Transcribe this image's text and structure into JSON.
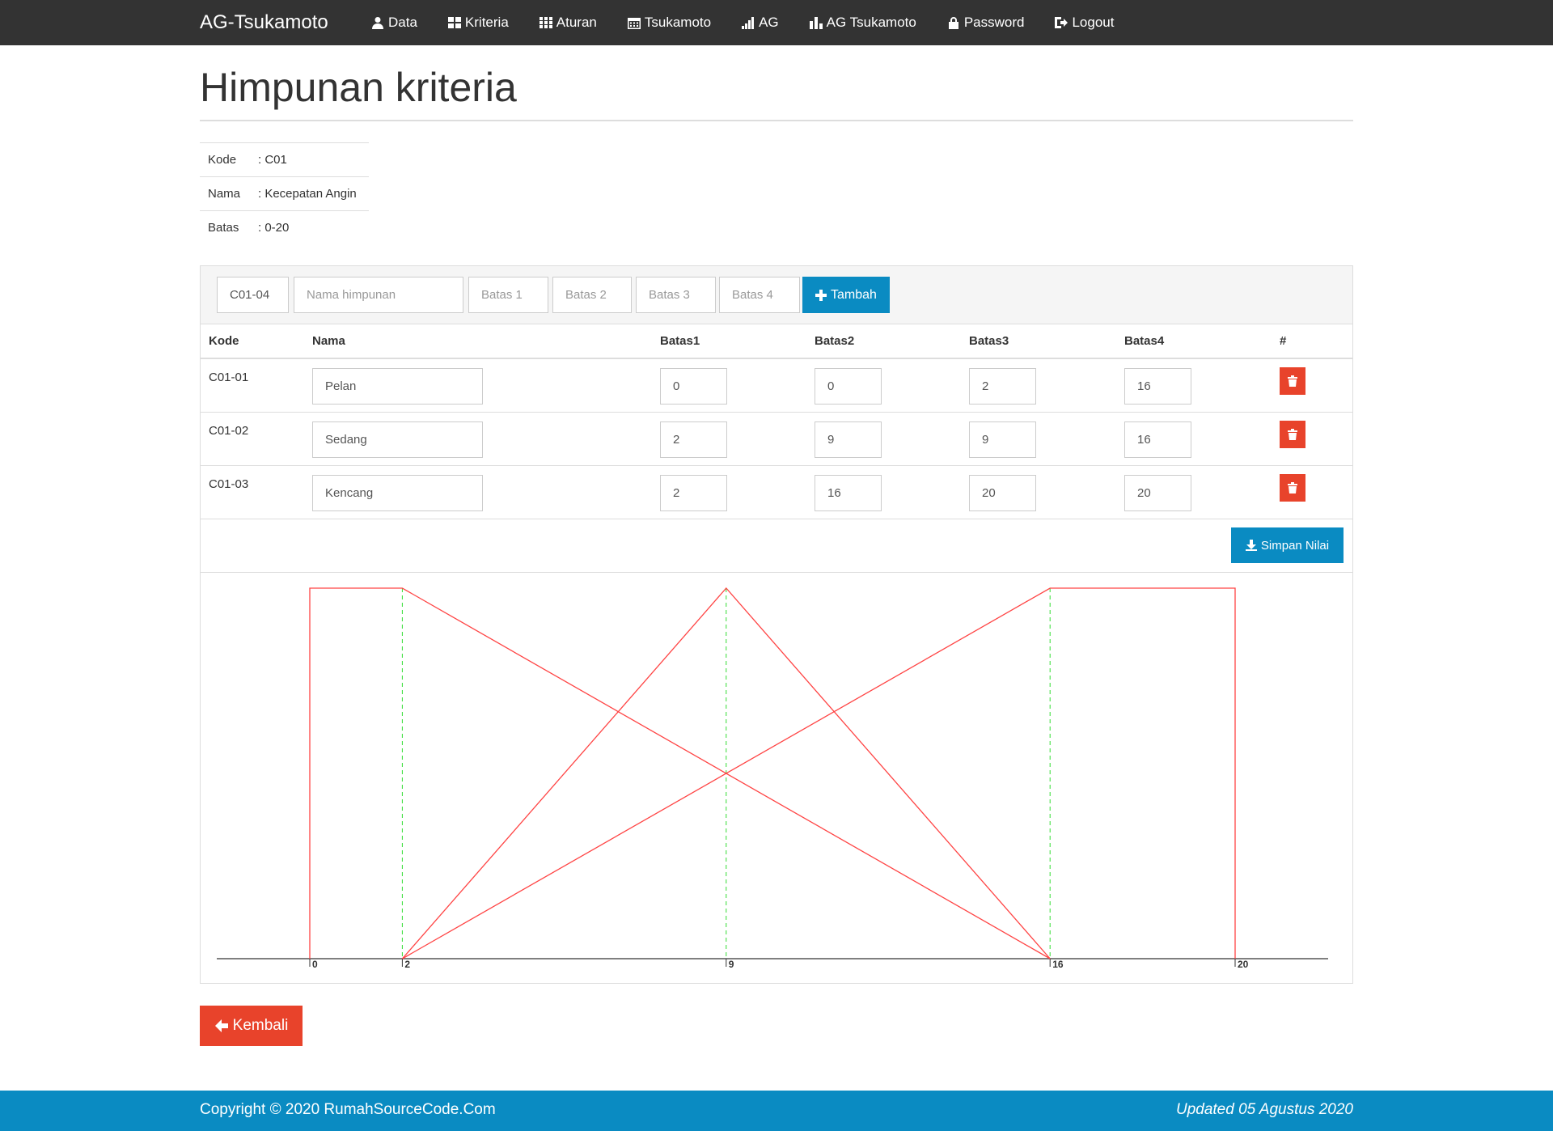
{
  "nav": {
    "brand": "AG-Tsukamoto",
    "items": [
      {
        "label": "Data",
        "icon": "user-icon"
      },
      {
        "label": "Kriteria",
        "icon": "grid-icon"
      },
      {
        "label": "Aturan",
        "icon": "grid-icon"
      },
      {
        "label": "Tsukamoto",
        "icon": "calendar-icon"
      },
      {
        "label": "AG",
        "icon": "signal-icon"
      },
      {
        "label": "AG Tsukamoto",
        "icon": "bar-chart-icon"
      },
      {
        "label": "Password",
        "icon": "lock-icon"
      },
      {
        "label": "Logout",
        "icon": "logout-icon"
      }
    ]
  },
  "page_title": "Himpunan kriteria",
  "info": [
    {
      "key": "Kode",
      "value": ": C01"
    },
    {
      "key": "Nama",
      "value": ": Kecepatan Angin"
    },
    {
      "key": "Batas",
      "value": ": 0-20"
    }
  ],
  "add_form": {
    "kode_value": "C01-04",
    "nama_placeholder": "Nama himpunan",
    "batas1_placeholder": "Batas 1",
    "batas2_placeholder": "Batas 2",
    "batas3_placeholder": "Batas 3",
    "batas4_placeholder": "Batas 4",
    "add_label": "Tambah"
  },
  "table": {
    "headers": [
      "Kode",
      "Nama",
      "Batas1",
      "Batas2",
      "Batas3",
      "Batas4",
      "#"
    ],
    "rows": [
      {
        "kode": "C01-01",
        "nama": "Pelan",
        "b1": "0",
        "b2": "0",
        "b3": "2",
        "b4": "16"
      },
      {
        "kode": "C01-02",
        "nama": "Sedang",
        "b1": "2",
        "b2": "9",
        "b3": "9",
        "b4": "16"
      },
      {
        "kode": "C01-03",
        "nama": "Kencang",
        "b1": "2",
        "b2": "16",
        "b3": "20",
        "b4": "20"
      }
    ],
    "save_label": "Simpan Nilai"
  },
  "chart_data": {
    "type": "line",
    "title": "",
    "xlabel": "",
    "ylabel": "",
    "xlim": [
      0,
      20
    ],
    "ylim": [
      0,
      1
    ],
    "x_ticks": [
      0,
      2,
      9,
      16,
      20
    ],
    "grid": false,
    "series_color": "#ff4444",
    "guide_color": "#33dd33",
    "series": [
      {
        "x": [
          0,
          0,
          2,
          16
        ],
        "y": [
          0,
          1,
          1,
          0
        ]
      },
      {
        "x": [
          2,
          9,
          16
        ],
        "y": [
          0,
          1,
          0
        ]
      },
      {
        "x": [
          2,
          16,
          20,
          20
        ],
        "y": [
          0,
          1,
          1,
          0
        ]
      }
    ]
  },
  "back_label": "Kembali",
  "footer": {
    "copyright": "Copyright © 2020 RumahSourceCode.Com",
    "updated": "Updated 05 Agustus 2020"
  }
}
